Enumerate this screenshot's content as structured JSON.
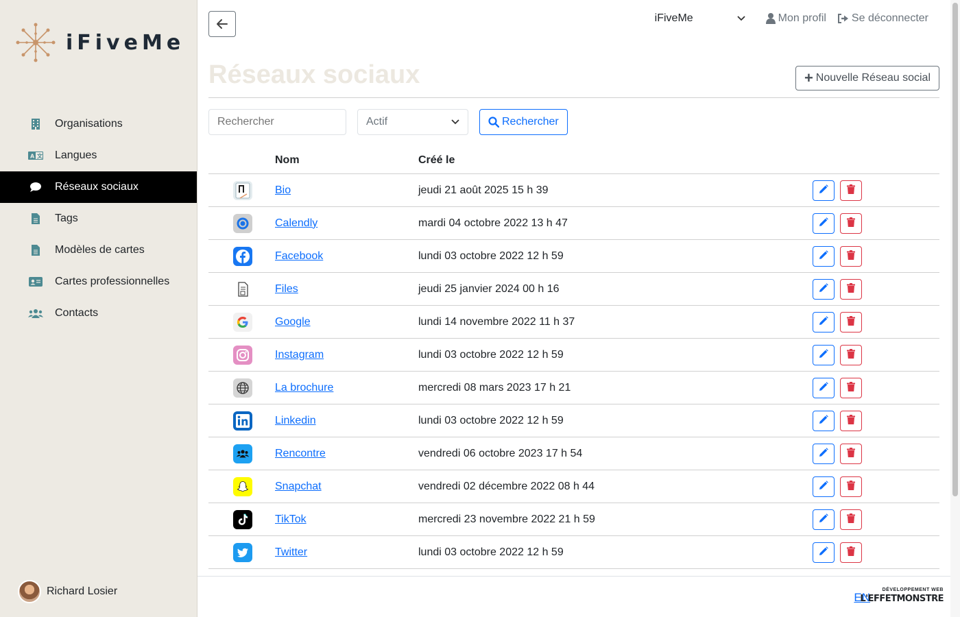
{
  "app": {
    "logo_text": "iFiveMe"
  },
  "sidebar": {
    "items": [
      {
        "label": "Organisations",
        "icon": "building-icon"
      },
      {
        "label": "Langues",
        "icon": "language-icon"
      },
      {
        "label": "Réseaux sociaux",
        "icon": "comment-icon",
        "active": true
      },
      {
        "label": "Tags",
        "icon": "document-icon"
      },
      {
        "label": "Modèles de cartes",
        "icon": "document-icon"
      },
      {
        "label": "Cartes professionnelles",
        "icon": "id-card-icon"
      },
      {
        "label": "Contacts",
        "icon": "users-icon"
      }
    ],
    "user_name": "Richard Losier"
  },
  "header": {
    "org_select": "iFiveMe",
    "profile_label": "Mon profil",
    "logout_label": "Se déconnecter"
  },
  "page": {
    "title": "Réseaux sociaux",
    "new_button": "Nouvelle Réseau social"
  },
  "filters": {
    "search_placeholder": "Rechercher",
    "status_value": "Actif",
    "search_button": "Rechercher"
  },
  "table": {
    "headers": {
      "name": "Nom",
      "created": "Créé le"
    },
    "rows": [
      {
        "name": "Bio",
        "created": "jeudi 21 août 2025 15 h 39",
        "icon": "bio-icon"
      },
      {
        "name": "Calendly",
        "created": "mardi 04 octobre 2022 13 h 47",
        "icon": "calendly-icon"
      },
      {
        "name": "Facebook",
        "created": "lundi 03 octobre 2022 12 h 59",
        "icon": "facebook-icon"
      },
      {
        "name": "Files",
        "created": "jeudi 25 janvier 2024 00 h 16",
        "icon": "files-icon"
      },
      {
        "name": "Google",
        "created": "lundi 14 novembre 2022 11 h 37",
        "icon": "google-icon"
      },
      {
        "name": "Instagram",
        "created": "lundi 03 octobre 2022 12 h 59",
        "icon": "instagram-icon"
      },
      {
        "name": "La brochure",
        "created": "mercredi 08 mars 2023 17 h 21",
        "icon": "globe-icon"
      },
      {
        "name": "Linkedin",
        "created": "lundi 03 octobre 2022 12 h 59",
        "icon": "linkedin-icon"
      },
      {
        "name": "Rencontre",
        "created": "vendredi 06 octobre 2023 17 h 54",
        "icon": "meetup-icon"
      },
      {
        "name": "Snapchat",
        "created": "vendredi 02 décembre 2022 08 h 44",
        "icon": "snapchat-icon"
      },
      {
        "name": "TikTok",
        "created": "mercredi 23 novembre 2022 21 h 59",
        "icon": "tiktok-icon"
      },
      {
        "name": "Twitter",
        "created": "lundi 03 octobre 2022 12 h 59",
        "icon": "twitter-icon"
      }
    ]
  },
  "footer": {
    "lang_link": "EN",
    "brand_line1": "DÉVELOPPEMENT WEB",
    "brand_line2": "L'EFFETMONSTRE"
  },
  "colors": {
    "primary": "#0d6efd",
    "danger": "#dc3545",
    "sidebar_bg": "#edeae3",
    "active_bg": "#000000",
    "logo_accent": "#c8956b"
  }
}
